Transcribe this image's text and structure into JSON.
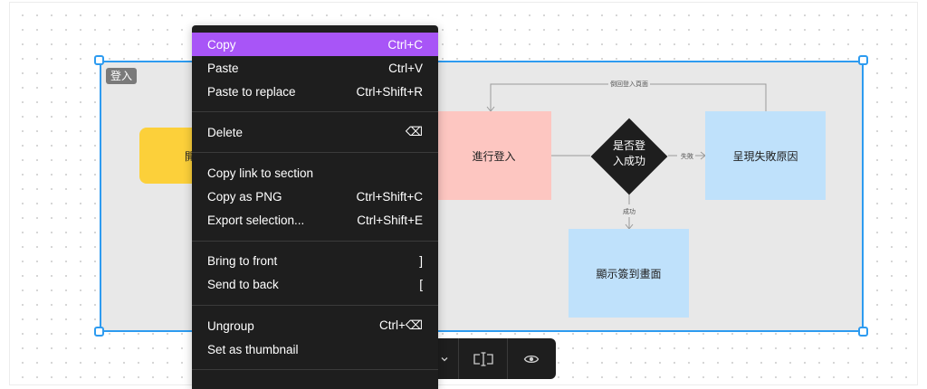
{
  "section": {
    "tag": "登入"
  },
  "flow": {
    "start_label": "開始",
    "login_label": "進行登入",
    "decision_label_line1": "是否登",
    "decision_label_line2": "入成功",
    "fail_label": "呈現失敗原因",
    "show_label": "顯示簽到畫面",
    "edge_fail": "失敗",
    "edge_success": "成功",
    "edge_back": "倒回登入頁面"
  },
  "menu": {
    "items": [
      {
        "label": "Copy",
        "shortcut": "Ctrl+C",
        "active": true
      },
      {
        "label": "Paste",
        "shortcut": "Ctrl+V"
      },
      {
        "label": "Paste to replace",
        "shortcut": "Ctrl+Shift+R"
      },
      {
        "label": "Delete",
        "shortcut": "⌫"
      },
      {
        "label": "Copy link to section",
        "shortcut": ""
      },
      {
        "label": "Copy as PNG",
        "shortcut": "Ctrl+Shift+C"
      },
      {
        "label": "Export selection...",
        "shortcut": "Ctrl+Shift+E"
      },
      {
        "label": "Bring to front",
        "shortcut": "]"
      },
      {
        "label": "Send to back",
        "shortcut": "["
      },
      {
        "label": "Ungroup",
        "shortcut": "Ctrl+⌫"
      },
      {
        "label": "Set as thumbnail",
        "shortcut": ""
      }
    ]
  },
  "toolbar": {
    "icons": [
      "chevron-down-icon",
      "text-cursor-icon",
      "eye-icon"
    ]
  },
  "colors": {
    "selection": "#2d9bf0",
    "menu_bg": "#1e1e1e",
    "menu_active": "#a855f7",
    "start_node": "#fcd03a",
    "login_node": "#fdc6c1",
    "result_node": "#bfe1fb"
  }
}
